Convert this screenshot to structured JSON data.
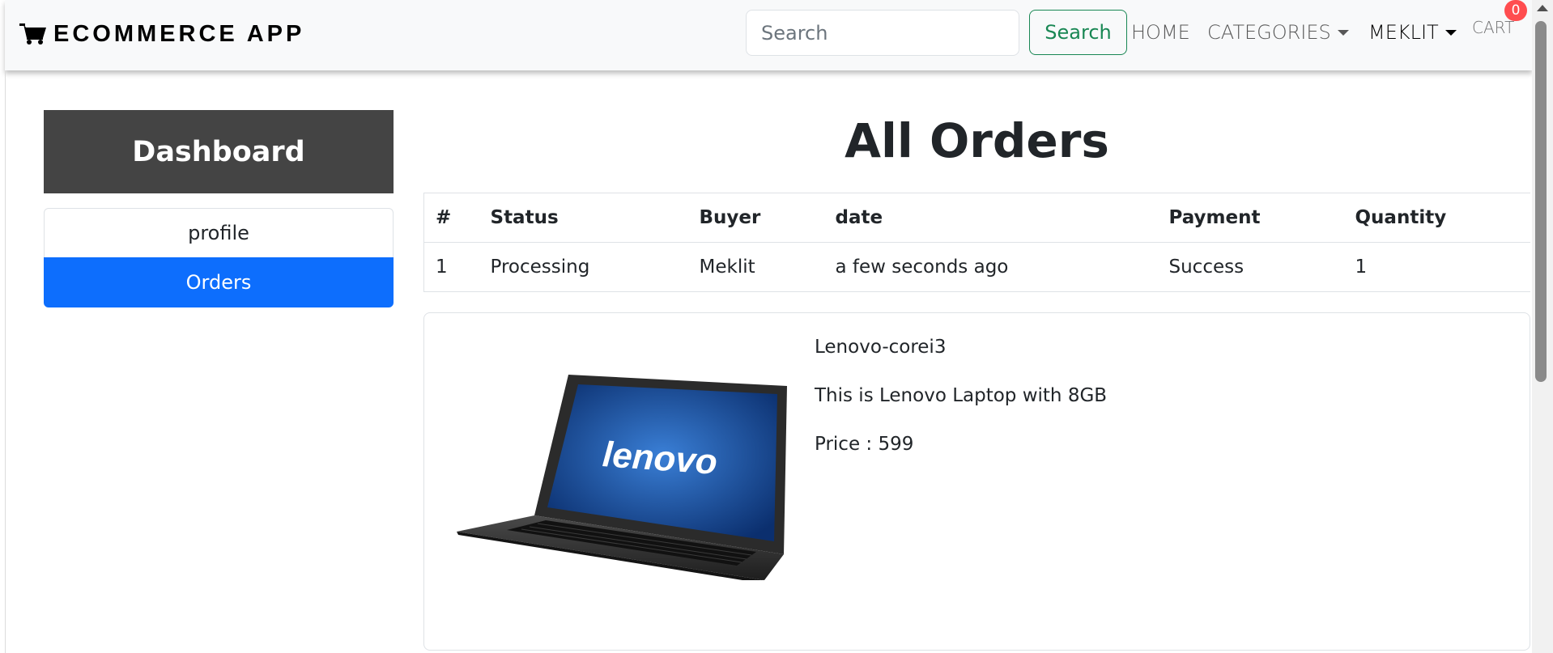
{
  "navbar": {
    "brand": "ECOMMERCE APP",
    "search": {
      "placeholder": "Search",
      "value": "",
      "button_label": "Search"
    },
    "links": {
      "home": "HOME",
      "categories": "CATEGORIES",
      "user": "MEKLIT",
      "cart": "CART"
    },
    "cart_count": "0"
  },
  "sidebar": {
    "title": "Dashboard",
    "items": [
      {
        "label": "profile"
      },
      {
        "label": "Orders"
      }
    ]
  },
  "main": {
    "title": "All Orders",
    "table": {
      "headers": [
        "#",
        "Status",
        "Buyer",
        "date",
        "Payment",
        "Quantity"
      ],
      "rows": [
        [
          "1",
          "Processing",
          "Meklit",
          "a few seconds ago",
          "Success",
          "1"
        ]
      ]
    },
    "product": {
      "name": "Lenovo-corei3",
      "description": "This is Lenovo Laptop with 8GB",
      "price": "Price : 599",
      "image_brand_text": "lenovo"
    }
  },
  "colors": {
    "primary": "#0d6efd",
    "success": "#198754",
    "dashboard_bg": "#444444",
    "badge": "#ff4d4f"
  }
}
